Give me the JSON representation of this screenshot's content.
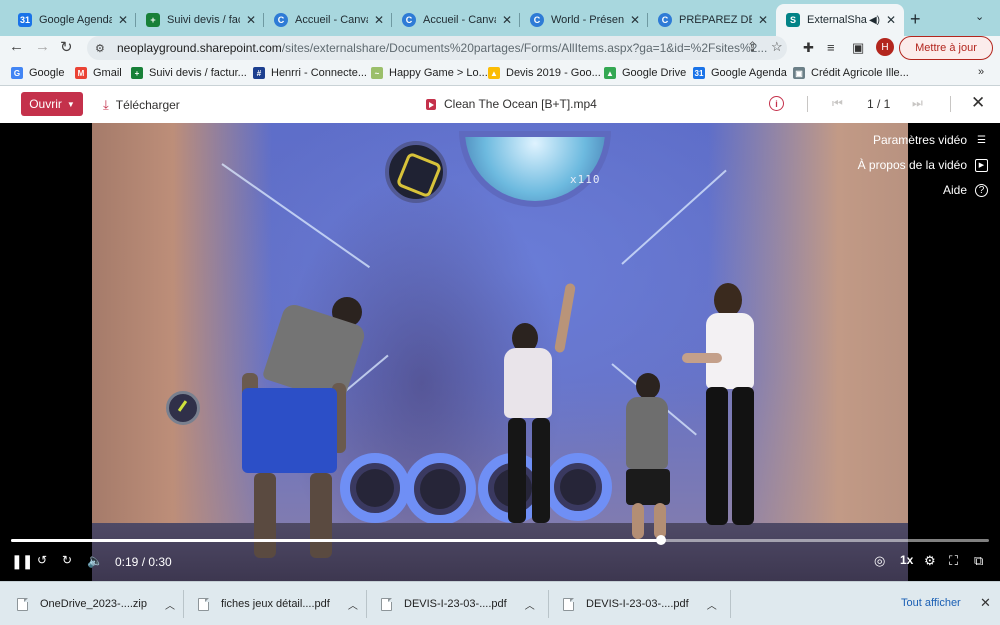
{
  "browser": {
    "tabs": [
      {
        "title": "Google Agenda -",
        "favicon_color": "#1a73e8",
        "favicon_glyph": "31",
        "active": false
      },
      {
        "title": "Suivi devis / factu",
        "favicon_color": "#188038",
        "favicon_glyph": "+",
        "active": false
      },
      {
        "title": "Accueil - Canva",
        "favicon_color": "#2e7bd6",
        "favicon_glyph": "C",
        "active": false
      },
      {
        "title": "Accueil - Canva",
        "favicon_color": "#2e7bd6",
        "favicon_glyph": "C",
        "active": false
      },
      {
        "title": "World - Présentat",
        "favicon_color": "#2e7bd6",
        "favicon_glyph": "C",
        "active": false
      },
      {
        "title": "PRÉPAREZ DÈS M",
        "favicon_color": "#2e7bd6",
        "favicon_glyph": "C",
        "active": false
      },
      {
        "title": "ExternalShare",
        "favicon_color": "#038387",
        "favicon_glyph": "S",
        "active": true
      }
    ],
    "address": {
      "host": "neoplayground.sharepoint.com",
      "path": "/sites/externalshare/Documents%20partages/Forms/AllItems.aspx?ga=1&id=%2Fsites%2..."
    },
    "profile_initial": "H",
    "update_button": "Mettre à jour",
    "bookmarks": [
      {
        "label": "Google",
        "icon": "google-icon",
        "color": "#4285f4",
        "glyph": "G"
      },
      {
        "label": "Gmail",
        "icon": "gmail-icon",
        "color": "#ea4335",
        "glyph": "M"
      },
      {
        "label": "Suivi devis / factur...",
        "icon": "sheets-icon",
        "color": "#188038",
        "glyph": "+"
      },
      {
        "label": "Henrri - Connecte...",
        "icon": "henrri-icon",
        "color": "#1d3f8f",
        "glyph": "#"
      },
      {
        "label": "Happy Game > Lo...",
        "icon": "happy-game-icon",
        "color": "#9bbf6a",
        "glyph": "~"
      },
      {
        "label": "Devis 2019 - Goo...",
        "icon": "drive-icon",
        "color": "#fbbc04",
        "glyph": "▲"
      },
      {
        "label": "Google Drive",
        "icon": "drive-icon",
        "color": "#34a853",
        "glyph": "▲"
      },
      {
        "label": "Google Agenda",
        "icon": "calendar-icon",
        "color": "#1a73e8",
        "glyph": "31"
      },
      {
        "label": "Crédit Agricole Ille...",
        "icon": "credit-agricole-icon",
        "color": "#6b7f87",
        "glyph": "▣"
      }
    ]
  },
  "viewer": {
    "open_button": "Ouvrir",
    "download_button": "Télécharger",
    "file_name": "Clean The Ocean [B+T].mp4",
    "page_indicator": "1 / 1",
    "video_menu": {
      "settings": "Paramètres vidéo",
      "about": "À propos de la vidéo",
      "help": "Aide"
    },
    "video_overlay_score": "x110",
    "player": {
      "current_time": "0:19",
      "duration": "0:30",
      "time_display": "0:19 / 0:30",
      "progress_fraction": 0.665,
      "speed": "1x"
    }
  },
  "downloads": {
    "items": [
      {
        "name": "OneDrive_2023-....zip"
      },
      {
        "name": "fiches jeux détail....pdf"
      },
      {
        "name": "DEVIS-I-23-03-....pdf"
      },
      {
        "name": "DEVIS-I-23-03-....pdf"
      }
    ],
    "show_all": "Tout afficher"
  },
  "colors": {
    "tabstrip_bg": "#a8d7de",
    "sharepoint_accent": "#c4314b",
    "update_red": "#b3261e",
    "link_blue": "#1a5fb4"
  }
}
